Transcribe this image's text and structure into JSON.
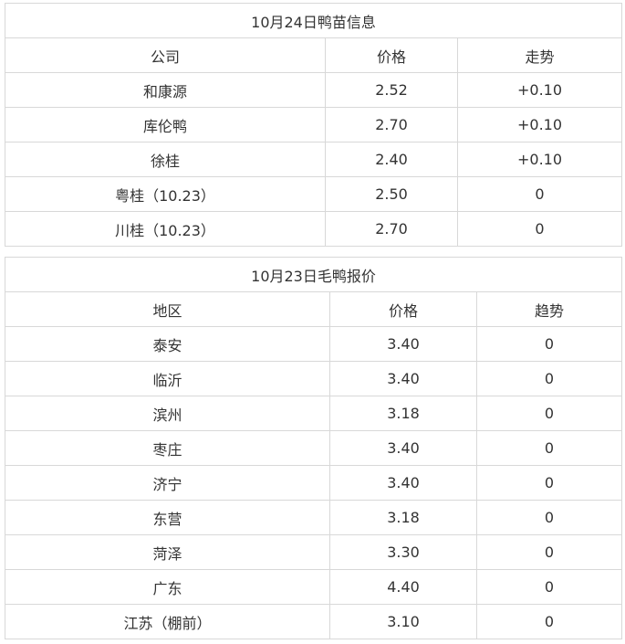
{
  "duckling": {
    "title": "10月24日鸭苗信息",
    "headers": [
      "公司",
      "价格",
      "走势"
    ],
    "rows": [
      [
        "和康源",
        "2.52",
        "+0.10"
      ],
      [
        "库伦鸭",
        "2.70",
        "+0.10"
      ],
      [
        "徐桂",
        "2.40",
        "+0.10"
      ],
      [
        "粤桂（10.23）",
        "2.50",
        "0"
      ],
      [
        "川桂（10.23）",
        "2.70",
        "0"
      ]
    ]
  },
  "duck": {
    "title": "10月23日毛鸭报价",
    "headers": [
      "地区",
      "价格",
      "趋势"
    ],
    "rows": [
      [
        "泰安",
        "3.40",
        "0"
      ],
      [
        "临沂",
        "3.40",
        "0"
      ],
      [
        "滨州",
        "3.18",
        "0"
      ],
      [
        "枣庄",
        "3.40",
        "0"
      ],
      [
        "济宁",
        "3.40",
        "0"
      ],
      [
        "东营",
        "3.18",
        "0"
      ],
      [
        "菏泽",
        "3.30",
        "0"
      ],
      [
        "广东",
        "4.40",
        "0"
      ],
      [
        "江苏（棚前）",
        "3.10",
        "0"
      ]
    ]
  }
}
